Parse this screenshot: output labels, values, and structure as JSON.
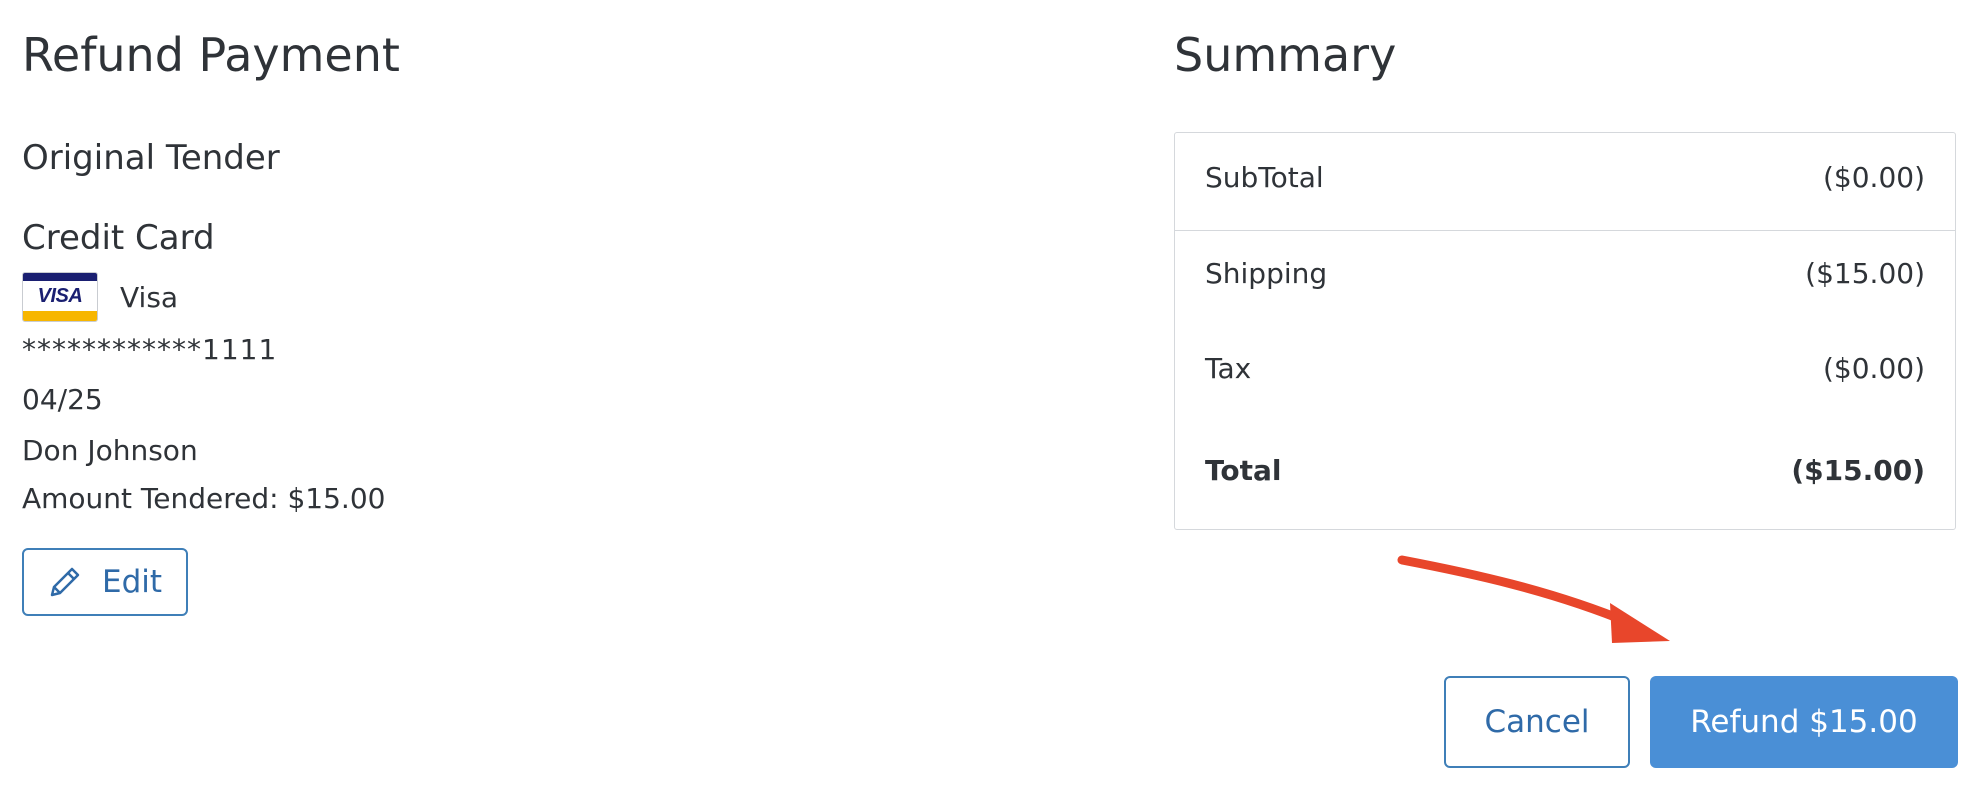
{
  "refund": {
    "title": "Refund Payment",
    "section_title": "Original Tender",
    "tender_type": "Credit Card",
    "card": {
      "brand_logo_text": "VISA",
      "brand": "Visa",
      "number": "************1111",
      "expiration": "04/25",
      "holder": "Don Johnson",
      "amount_tendered": "Amount Tendered: $15.00"
    },
    "edit_label": "Edit",
    "edit_icon": "pencil-icon"
  },
  "summary": {
    "title": "Summary",
    "rows": [
      {
        "label": "SubTotal",
        "value": "($0.00)"
      },
      {
        "label": "Shipping",
        "value": "($15.00)"
      },
      {
        "label": "Tax",
        "value": "($0.00)"
      },
      {
        "label": "Total",
        "value": "($15.00)"
      }
    ]
  },
  "actions": {
    "cancel_label": "Cancel",
    "refund_label": "Refund $15.00"
  },
  "colors": {
    "primary": "#4a8fd6",
    "outline": "#3f7fb8",
    "annotation_arrow": "#e8462b",
    "visa_blue": "#1a1f71",
    "visa_gold": "#f7b600"
  }
}
